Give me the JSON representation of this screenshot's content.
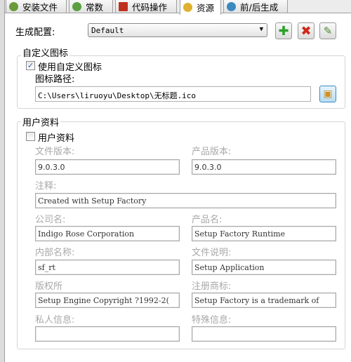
{
  "tabs": [
    {
      "label": "安装文件",
      "color": "#6a9a3a"
    },
    {
      "label": "常数",
      "color": "#5aa040"
    },
    {
      "label": "代码操作",
      "color": "#c03020"
    },
    {
      "label": "资源",
      "color": "#e0b030"
    },
    {
      "label": "前/后生成",
      "color": "#3a8ac0"
    }
  ],
  "active_tab": "资源",
  "build_config": {
    "label": "生成配置:",
    "value": "Default"
  },
  "buttons": {
    "add": "add-icon",
    "delete": "delete-icon",
    "edit": "edit-icon",
    "browse": "browse-icon"
  },
  "custom_icon": {
    "legend": "自定义图标",
    "checkbox_label": "使用自定义图标",
    "checked": true,
    "path_label": "图标路径:",
    "path_value": "C:\\Users\\liruoyu\\Desktop\\无标题.ico"
  },
  "user_info": {
    "legend": "用户资料",
    "checkbox_label": "用户资料",
    "checked": false,
    "file_version_label": "文件版本:",
    "file_version": "9.0.3.0",
    "product_version_label": "产品版本:",
    "product_version": "9.0.3.0",
    "comment_label": "注释:",
    "comment": "Created with Setup Factory",
    "company_label": "公司名:",
    "company": "Indigo Rose Corporation",
    "product_name_label": "产品名:",
    "product_name": "Setup Factory Runtime",
    "internal_name_label": "内部名称:",
    "internal_name": "sf_rt",
    "file_desc_label": "文件说明:",
    "file_desc": "Setup Application",
    "copyright_label": "版权所",
    "copyright": "Setup Engine Copyright ?1992-2(",
    "trademark_label": "注册商标:",
    "trademark": "Setup Factory is a trademark of",
    "private_label": "私人信息:",
    "private": "",
    "special_label": "特殊信息:",
    "special": ""
  }
}
